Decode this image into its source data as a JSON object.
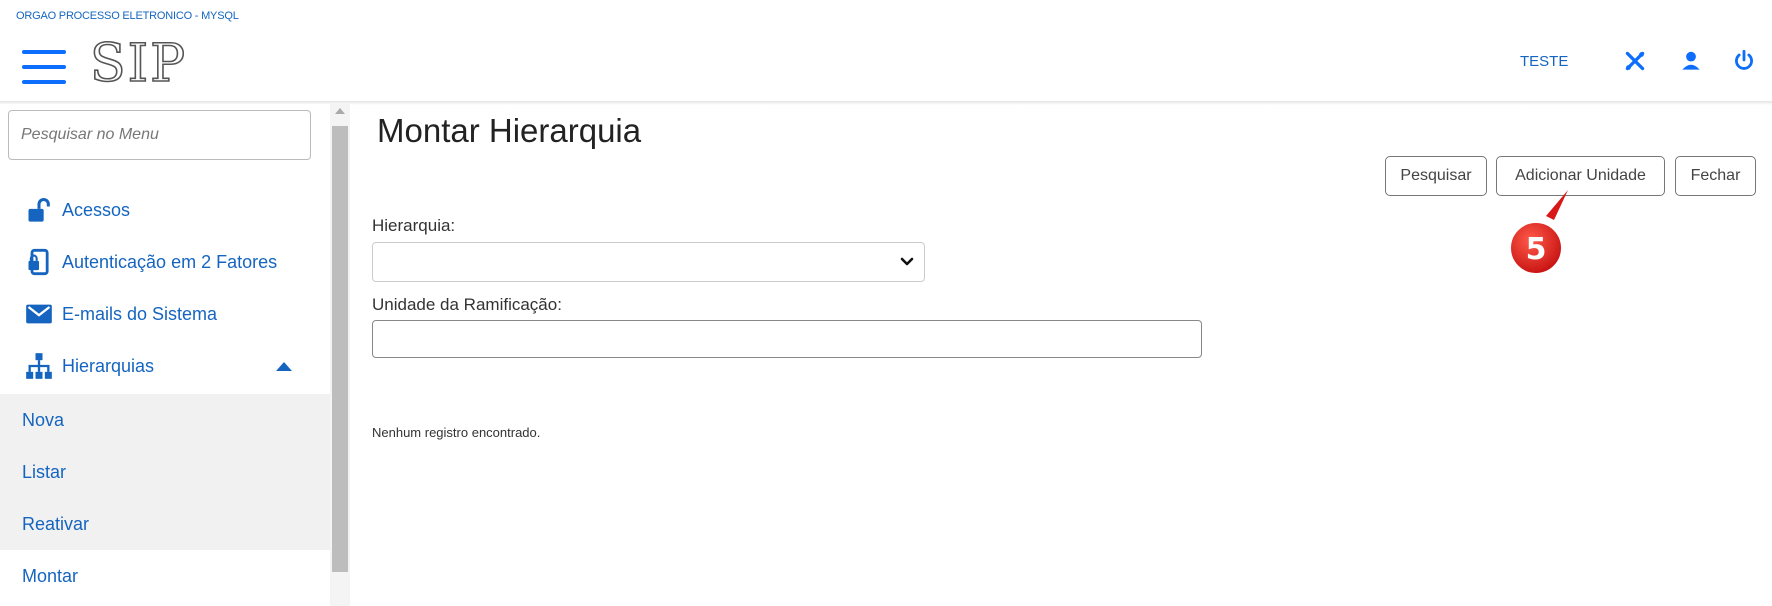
{
  "header": {
    "org_name": "ORGAO PROCESSO ELETRONICO - MYSQL",
    "logo_text": "SIP",
    "user_label": "TESTE",
    "icons": [
      "tools-icon",
      "user-icon",
      "power-icon"
    ]
  },
  "sidebar": {
    "search_placeholder": "Pesquisar no Menu",
    "items": [
      {
        "label": "Acessos",
        "icon": "lock-open-icon"
      },
      {
        "label": "Autenticação em 2 Fatores",
        "icon": "mobile-lock-icon"
      },
      {
        "label": "E-mails do Sistema",
        "icon": "envelope-icon"
      },
      {
        "label": "Hierarquias",
        "icon": "sitemap-icon",
        "expanded": true
      }
    ],
    "sub_items": [
      {
        "label": "Nova"
      },
      {
        "label": "Listar"
      },
      {
        "label": "Reativar"
      },
      {
        "label": "Montar"
      }
    ]
  },
  "main": {
    "title": "Montar Hierarquia",
    "buttons": {
      "search": "Pesquisar",
      "add_unit": "Adicionar Unidade",
      "close": "Fechar"
    },
    "fields": {
      "hierarchy_label": "Hierarquia:",
      "hierarchy_value": "",
      "branch_unit_label": "Unidade da Ramificação:",
      "branch_unit_value": ""
    },
    "empty_message": "Nenhum registro encontrado."
  },
  "callout": {
    "number": "5",
    "color": "#e31b1b"
  },
  "colors": {
    "accent": "#1565c0",
    "hamburger": "#0d6efd"
  }
}
